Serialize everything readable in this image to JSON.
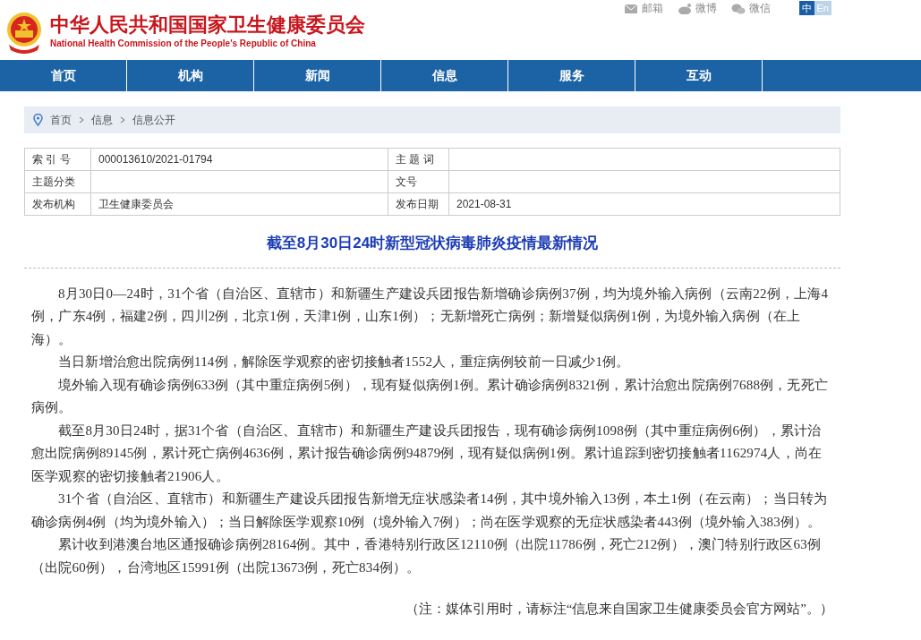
{
  "header": {
    "title_cn": "中华人民共和国国家卫生健康委员会",
    "title_en": "National Health Commission of the People's Republic of China",
    "links": [
      {
        "kind": "mail",
        "label": "邮箱"
      },
      {
        "kind": "weibo",
        "label": "微博"
      },
      {
        "kind": "wechat",
        "label": "微信"
      }
    ],
    "languages": [
      {
        "label": "中",
        "selected": true
      },
      {
        "label": "En",
        "selected": false
      }
    ]
  },
  "nav": [
    {
      "label": "首页"
    },
    {
      "label": "机构"
    },
    {
      "label": "新闻"
    },
    {
      "label": "信息"
    },
    {
      "label": "服务"
    },
    {
      "label": "互动"
    }
  ],
  "breadcrumb": [
    "首页",
    "信息",
    "信息公开"
  ],
  "info_table": [
    {
      "label_1": "索 引 号",
      "value_1": "000013610/2021-01794",
      "label_2": "主 题 词"
    },
    {
      "label_1": "主题分类",
      "label_2": "文号"
    },
    {
      "label_1": "发布机构",
      "value_1": "卫生健康委员会",
      "label_2": "发布日期",
      "value_2": "2021-08-31"
    }
  ],
  "article": {
    "title": "截至8月30日24时新型冠状病毒肺炎疫情最新情况",
    "paragraphs": [
      "8月30日0—24时，31个省（自治区、直辖市）和新疆生产建设兵团报告新增确诊病例37例，均为境外输入病例（云南22例，上海4例，广东4例，福建2例，四川2例，北京1例，天津1例，山东1例）；无新增死亡病例；新增疑似病例1例，为境外输入病例（在上海）。",
      "当日新增治愈出院病例114例，解除医学观察的密切接触者1552人，重症病例较前一日减少1例。",
      "境外输入现有确诊病例633例（其中重症病例5例），现有疑似病例1例。累计确诊病例8321例，累计治愈出院病例7688例，无死亡病例。",
      "截至8月30日24时，据31个省（自治区、直辖市）和新疆生产建设兵团报告，现有确诊病例1098例（其中重症病例6例），累计治愈出院病例89145例，累计死亡病例4636例，累计报告确诊病例94879例，现有疑似病例1例。累计追踪到密切接触者1162974人，尚在医学观察的密切接触者21906人。",
      "31个省（自治区、直辖市）和新疆生产建设兵团报告新增无症状感染者14例，其中境外输入13例，本土1例（在云南）；当日转为确诊病例4例（均为境外输入）；当日解除医学观察10例（境外输入7例）；尚在医学观察的无症状感染者443例（境外输入383例）。",
      "累计收到港澳台地区通报确诊病例28164例。其中，香港特别行政区12110例（出院11786例，死亡212例），澳门特别行政区63例（出院60例），台湾地区15991例（出院13673例，死亡834例）。"
    ],
    "note": "（注：媒体引用时，请标注“信息来自国家卫生健康委员会官方网站”。）"
  }
}
